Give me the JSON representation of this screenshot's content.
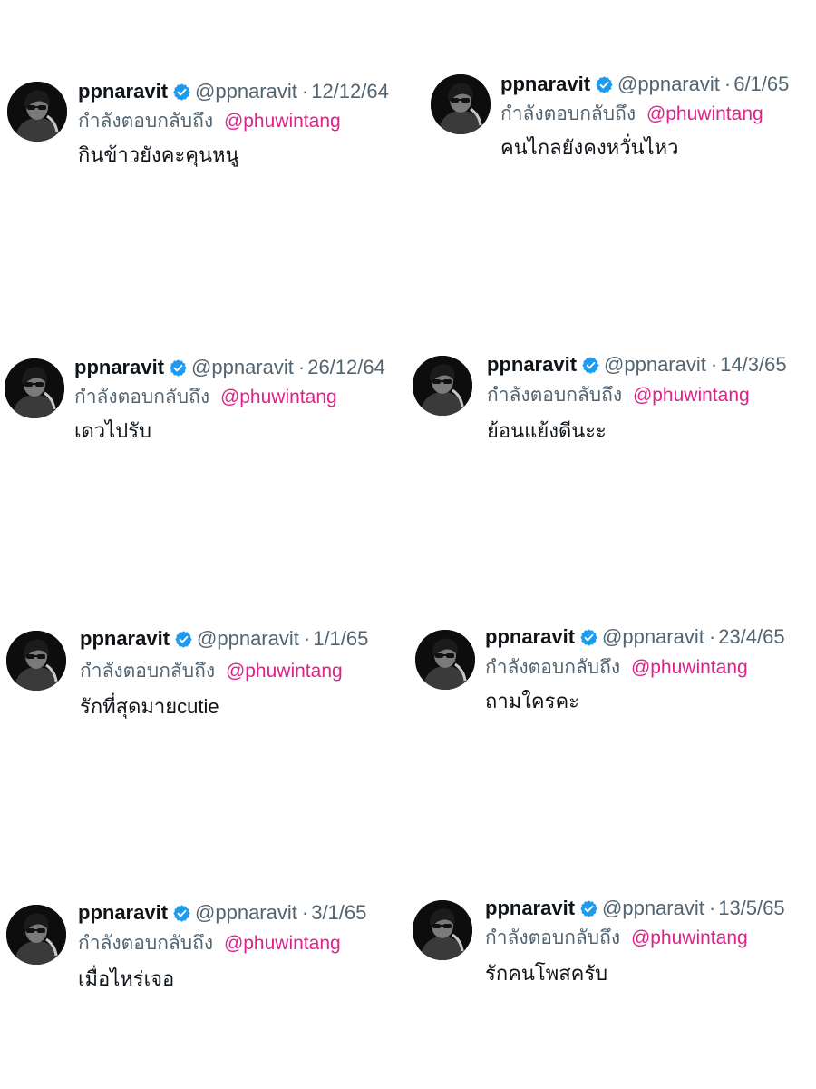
{
  "tweets": [
    {
      "name": "ppnaravit",
      "handle": "@ppnaravit",
      "sep": "·",
      "date": "12/12/64",
      "reply_prefix": "กำลังตอบกลับถึง",
      "reply_to": "@phuwintang",
      "text": "กินข้าวยังคะคุนหนู"
    },
    {
      "name": "ppnaravit",
      "handle": "@ppnaravit",
      "sep": "·",
      "date": "6/1/65",
      "reply_prefix": "กำลังตอบกลับถึง",
      "reply_to": "@phuwintang",
      "text": "คนไกลยังคงหวั่นไหว"
    },
    {
      "name": "ppnaravit",
      "handle": "@ppnaravit",
      "sep": "·",
      "date": "26/12/64",
      "reply_prefix": "กำลังตอบกลับถึง",
      "reply_to": "@phuwintang",
      "text": "เดวไปรับ"
    },
    {
      "name": "ppnaravit",
      "handle": "@ppnaravit",
      "sep": "·",
      "date": "14/3/65",
      "reply_prefix": "กำลังตอบกลับถึง",
      "reply_to": "@phuwintang",
      "text": "ย้อนแย้งดีนะะ"
    },
    {
      "name": "ppnaravit",
      "handle": "@ppnaravit",
      "sep": "·",
      "date": "1/1/65",
      "reply_prefix": "กำลังตอบกลับถึง",
      "reply_to": "@phuwintang",
      "text": "รักที่สุดมายcutie"
    },
    {
      "name": "ppnaravit",
      "handle": "@ppnaravit",
      "sep": "·",
      "date": "23/4/65",
      "reply_prefix": "กำลังตอบกลับถึง",
      "reply_to": "@phuwintang",
      "text": "ถามใครคะ"
    },
    {
      "name": "ppnaravit",
      "handle": "@ppnaravit",
      "sep": "·",
      "date": "3/1/65",
      "reply_prefix": "กำลังตอบกลับถึง",
      "reply_to": "@phuwintang",
      "text": "เมื่อไหร่เจอ"
    },
    {
      "name": "ppnaravit",
      "handle": "@ppnaravit",
      "sep": "·",
      "date": "13/5/65",
      "reply_prefix": "กำลังตอบกลับถึง",
      "reply_to": "@phuwintang",
      "text": "รักคนโพสครับ"
    }
  ],
  "icons": {
    "avatar": "profile-photo",
    "badge": "verified-badge-icon"
  },
  "colors": {
    "verified": "#1d9bf0",
    "mention": "#e0218a",
    "meta": "#536471",
    "text": "#0f1419"
  }
}
